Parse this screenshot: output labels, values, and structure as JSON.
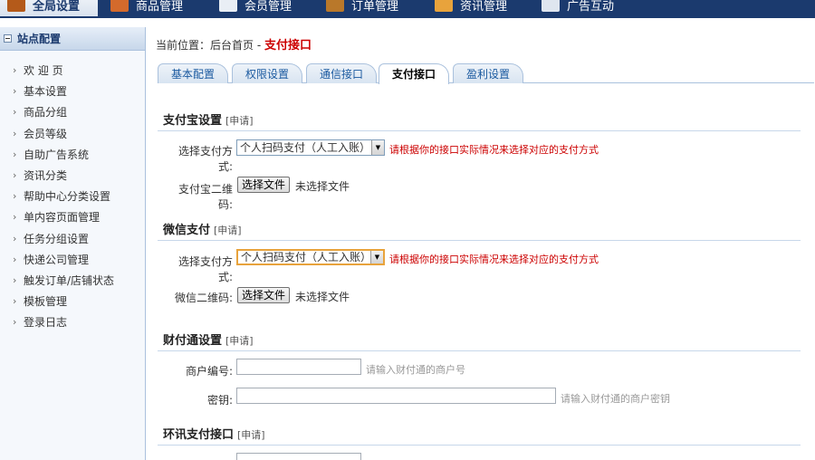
{
  "topnav": {
    "items": [
      {
        "label": "全局设置",
        "icon": "home-icon"
      },
      {
        "label": "商品管理",
        "icon": "grid-icon"
      },
      {
        "label": "会员管理",
        "icon": "user-card-icon"
      },
      {
        "label": "订单管理",
        "icon": "wallet-icon"
      },
      {
        "label": "资讯管理",
        "icon": "folder-icon"
      },
      {
        "label": "广告互动",
        "icon": "list-icon"
      }
    ]
  },
  "sidebar": {
    "title": "站点配置",
    "items": [
      {
        "label": "欢 迎 页"
      },
      {
        "label": "基本设置"
      },
      {
        "label": "商品分组"
      },
      {
        "label": "会员等级"
      },
      {
        "label": "自助广告系统"
      },
      {
        "label": "资讯分类"
      },
      {
        "label": "帮助中心分类设置"
      },
      {
        "label": "单内容页面管理"
      },
      {
        "label": "任务分组设置"
      },
      {
        "label": "快递公司管理"
      },
      {
        "label": "触发订单/店铺状态"
      },
      {
        "label": "模板管理"
      },
      {
        "label": "登录日志"
      }
    ]
  },
  "breadcrumb": {
    "prefix": "当前位置：后台首页 -",
    "current": "支付接口"
  },
  "tabs": [
    {
      "label": "基本配置"
    },
    {
      "label": "权限设置"
    },
    {
      "label": "通信接口"
    },
    {
      "label": "支付接口"
    },
    {
      "label": "盈利设置"
    }
  ],
  "alipay": {
    "title": "支付宝设置",
    "apply": "[申请]",
    "method_label": "选择支付方式:",
    "method_value": "个人扫码支付（人工入账）",
    "method_hint": "请根据你的接口实际情况来选择对应的支付方式",
    "qr_label": "支付宝二维码:",
    "file_button": "选择文件",
    "file_status": "未选择文件"
  },
  "wechat": {
    "title": "微信支付",
    "apply": "[申请]",
    "method_label": "选择支付方式:",
    "method_value": "个人扫码支付（人工入账）",
    "method_hint": "请根据你的接口实际情况来选择对应的支付方式",
    "qr_label": "微信二维码:",
    "file_button": "选择文件",
    "file_status": "未选择文件"
  },
  "tenpay": {
    "title": "财付通设置",
    "apply": "[申请]",
    "merchant_label": "商户编号:",
    "merchant_placeholder": "请输入财付通的商户号",
    "key_label": "密钥:",
    "key_placeholder": "请输入财付通的商户密钥"
  },
  "huanxun": {
    "title": "环讯支付接口",
    "apply": "[申请]"
  }
}
